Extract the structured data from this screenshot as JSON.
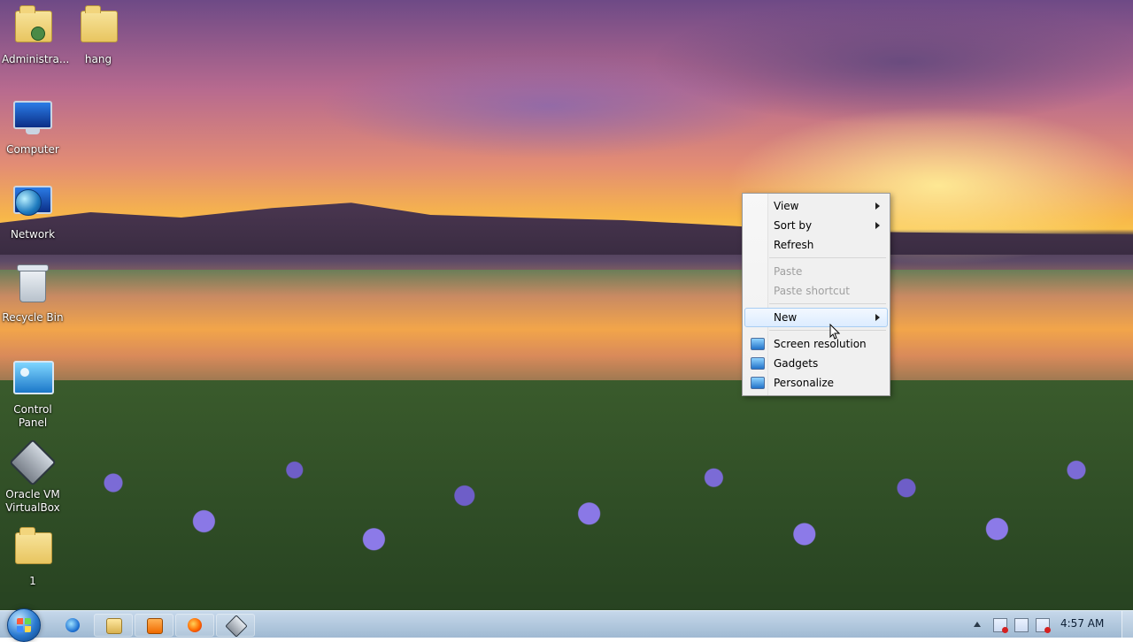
{
  "desktop": {
    "icons": [
      {
        "label": "Administra...",
        "icon": "user-folder-icon"
      },
      {
        "label": "hang",
        "icon": "zip-folder-icon"
      },
      {
        "label": "Computer",
        "icon": "computer-icon"
      },
      {
        "label": "Network",
        "icon": "network-icon"
      },
      {
        "label": "Recycle Bin",
        "icon": "recycle-bin-icon"
      },
      {
        "label": "Control Panel",
        "icon": "control-panel-icon"
      },
      {
        "label": "Oracle VM VirtualBox",
        "icon": "virtualbox-icon"
      },
      {
        "label": "1",
        "icon": "zip-folder-icon"
      }
    ]
  },
  "context_menu": {
    "items": [
      {
        "label": "View",
        "has_submenu": true,
        "enabled": true
      },
      {
        "label": "Sort by",
        "has_submenu": true,
        "enabled": true
      },
      {
        "label": "Refresh",
        "has_submenu": false,
        "enabled": true
      },
      {
        "label": "Paste",
        "has_submenu": false,
        "enabled": false
      },
      {
        "label": "Paste shortcut",
        "has_submenu": false,
        "enabled": false
      },
      {
        "label": "New",
        "has_submenu": true,
        "enabled": true,
        "highlighted": true
      },
      {
        "label": "Screen resolution",
        "icon": "screen-resolution-icon",
        "enabled": true
      },
      {
        "label": "Gadgets",
        "icon": "gadgets-icon",
        "enabled": true
      },
      {
        "label": "Personalize",
        "icon": "personalize-icon",
        "enabled": true
      }
    ]
  },
  "taskbar": {
    "start": {
      "icon": "windows-start-icon"
    },
    "pinned": [
      {
        "name": "internet-explorer",
        "icon": "ie-icon"
      },
      {
        "name": "windows-explorer",
        "icon": "folder-icon"
      },
      {
        "name": "media-player",
        "icon": "media-player-icon"
      },
      {
        "name": "firefox",
        "icon": "firefox-icon"
      },
      {
        "name": "virtualbox",
        "icon": "virtualbox-icon"
      }
    ],
    "tray": {
      "time": "4:57 AM",
      "icons": [
        "show-hidden-icons-icon",
        "action-center-icon",
        "network-icon",
        "volume-muted-icon"
      ]
    }
  }
}
